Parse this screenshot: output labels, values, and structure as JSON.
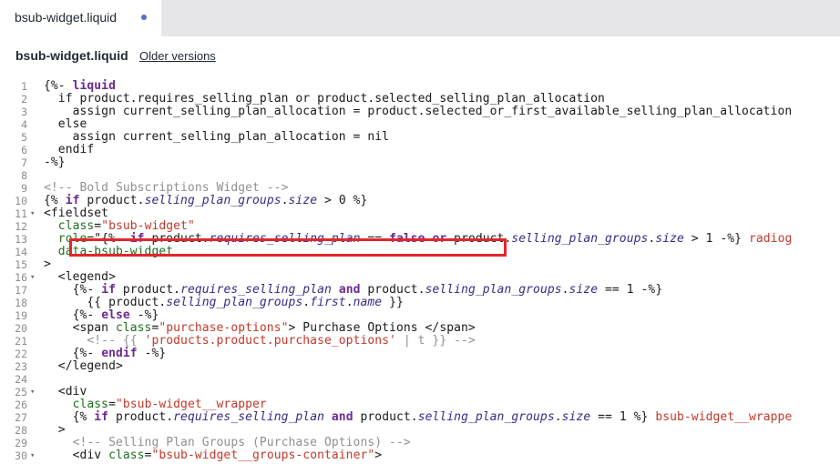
{
  "tab": {
    "label": "bsub-widget.liquid",
    "unsaved_indicator_color": "#5c6ac4"
  },
  "header": {
    "file_name": "bsub-widget.liquid",
    "older_versions_label": "Older versions"
  },
  "highlight_color": "#e3262d",
  "editor": {
    "lines": [
      {
        "n": "1",
        "fold": "",
        "segs": [
          [
            "t",
            "{%- "
          ],
          [
            "kw",
            "liquid"
          ]
        ]
      },
      {
        "n": "2",
        "fold": "",
        "segs": [
          [
            "t",
            "  if product.requires_selling_plan or product.selected_selling_plan_allocation"
          ]
        ]
      },
      {
        "n": "3",
        "fold": "",
        "segs": [
          [
            "t",
            "    assign current_selling_plan_allocation = product.selected_or_first_available_selling_plan_allocation"
          ]
        ]
      },
      {
        "n": "4",
        "fold": "",
        "segs": [
          [
            "t",
            "  else"
          ]
        ]
      },
      {
        "n": "5",
        "fold": "",
        "segs": [
          [
            "t",
            "    assign current_selling_plan_allocation = nil"
          ]
        ]
      },
      {
        "n": "6",
        "fold": "",
        "segs": [
          [
            "t",
            "  endif"
          ]
        ]
      },
      {
        "n": "7",
        "fold": "",
        "segs": [
          [
            "t",
            "-%}"
          ]
        ]
      },
      {
        "n": "8",
        "fold": "",
        "segs": []
      },
      {
        "n": "9",
        "fold": "",
        "segs": [
          [
            "cmt",
            "<!-- Bold Subscriptions Widget -->"
          ]
        ]
      },
      {
        "n": "10",
        "fold": "",
        "segs": [
          [
            "t",
            "{% "
          ],
          [
            "kw",
            "if"
          ],
          [
            "t",
            " product."
          ],
          [
            "fn",
            "selling_plan_groups"
          ],
          [
            "t",
            "."
          ],
          [
            "fn",
            "size"
          ],
          [
            "t",
            " > 0 %}"
          ]
        ]
      },
      {
        "n": "11",
        "fold": "▾",
        "segs": [
          [
            "t",
            "<fieldset"
          ]
        ]
      },
      {
        "n": "12",
        "fold": "",
        "segs": [
          [
            "attr",
            "  class"
          ],
          [
            "t",
            "="
          ],
          [
            "str",
            "\"bsub-widget\""
          ]
        ]
      },
      {
        "n": "13",
        "fold": "",
        "segs": [
          [
            "attr",
            "  role"
          ],
          [
            "t",
            "=\"{%- "
          ],
          [
            "kw",
            "if"
          ],
          [
            "t",
            " product."
          ],
          [
            "fn",
            "requires_selling_plan"
          ],
          [
            "t",
            " == "
          ],
          [
            "kw",
            "false"
          ],
          [
            "t",
            " "
          ],
          [
            "kw",
            "or"
          ],
          [
            "t",
            " product."
          ],
          [
            "fn",
            "selling_plan_groups"
          ],
          [
            "t",
            "."
          ],
          [
            "fn",
            "size"
          ],
          [
            "t",
            " > 1 -%} "
          ],
          [
            "str",
            "radiog"
          ]
        ]
      },
      {
        "n": "14",
        "fold": "",
        "segs": [
          [
            "attr",
            "  data-bsub-widget"
          ]
        ]
      },
      {
        "n": "15",
        "fold": "",
        "segs": [
          [
            "t",
            ">"
          ]
        ]
      },
      {
        "n": "16",
        "fold": "▾",
        "segs": [
          [
            "t",
            "  <legend>"
          ]
        ]
      },
      {
        "n": "17",
        "fold": "",
        "segs": [
          [
            "t",
            "    {%- "
          ],
          [
            "kw",
            "if"
          ],
          [
            "t",
            " product."
          ],
          [
            "fn",
            "requires_selling_plan"
          ],
          [
            "t",
            " "
          ],
          [
            "kw",
            "and"
          ],
          [
            "t",
            " product."
          ],
          [
            "fn",
            "selling_plan_groups"
          ],
          [
            "t",
            "."
          ],
          [
            "fn",
            "size"
          ],
          [
            "t",
            " == 1 -%}"
          ]
        ]
      },
      {
        "n": "18",
        "fold": "",
        "segs": [
          [
            "t",
            "      {{ product."
          ],
          [
            "fn",
            "selling_plan_groups"
          ],
          [
            "t",
            "."
          ],
          [
            "fn",
            "first"
          ],
          [
            "t",
            "."
          ],
          [
            "fn",
            "name"
          ],
          [
            "t",
            " }}"
          ]
        ]
      },
      {
        "n": "19",
        "fold": "",
        "segs": [
          [
            "t",
            "    {%- "
          ],
          [
            "kw",
            "else"
          ],
          [
            "t",
            " -%}"
          ]
        ]
      },
      {
        "n": "20",
        "fold": "",
        "segs": [
          [
            "t",
            "    <span "
          ],
          [
            "attr",
            "class"
          ],
          [
            "t",
            "="
          ],
          [
            "str",
            "\"purchase-options\""
          ],
          [
            "t",
            "> Purchase Options </span>"
          ]
        ]
      },
      {
        "n": "21",
        "fold": "",
        "segs": [
          [
            "cmt",
            "      <!-- {{ "
          ],
          [
            "str",
            "'products.product.purchase_options'"
          ],
          [
            "cmt",
            " | t }} -->"
          ]
        ]
      },
      {
        "n": "22",
        "fold": "",
        "segs": [
          [
            "t",
            "    {%- "
          ],
          [
            "kw",
            "endif"
          ],
          [
            "t",
            " -%}"
          ]
        ]
      },
      {
        "n": "23",
        "fold": "",
        "segs": [
          [
            "t",
            "  </legend>"
          ]
        ]
      },
      {
        "n": "24",
        "fold": "",
        "segs": []
      },
      {
        "n": "25",
        "fold": "▾",
        "segs": [
          [
            "t",
            "  <div"
          ]
        ]
      },
      {
        "n": "26",
        "fold": "",
        "segs": [
          [
            "attr",
            "    class"
          ],
          [
            "t",
            "="
          ],
          [
            "str",
            "\"bsub-widget__wrapper"
          ]
        ]
      },
      {
        "n": "27",
        "fold": "",
        "segs": [
          [
            "t",
            "    {% "
          ],
          [
            "kw",
            "if"
          ],
          [
            "t",
            " product."
          ],
          [
            "fn",
            "requires_selling_plan"
          ],
          [
            "t",
            " "
          ],
          [
            "kw",
            "and"
          ],
          [
            "t",
            " product."
          ],
          [
            "fn",
            "selling_plan_groups"
          ],
          [
            "t",
            "."
          ],
          [
            "fn",
            "size"
          ],
          [
            "t",
            " == 1 %} "
          ],
          [
            "str",
            "bsub-widget__wrappe"
          ]
        ]
      },
      {
        "n": "28",
        "fold": "",
        "segs": [
          [
            "t",
            "  >"
          ]
        ]
      },
      {
        "n": "29",
        "fold": "",
        "segs": [
          [
            "cmt",
            "    <!-- Selling Plan Groups (Purchase Options) -->"
          ]
        ]
      },
      {
        "n": "30",
        "fold": "▾",
        "segs": [
          [
            "t",
            "    <div "
          ],
          [
            "attr",
            "class"
          ],
          [
            "t",
            "="
          ],
          [
            "str",
            "\"bsub-widget__groups-container\""
          ],
          [
            "t",
            ">"
          ]
        ]
      }
    ]
  }
}
